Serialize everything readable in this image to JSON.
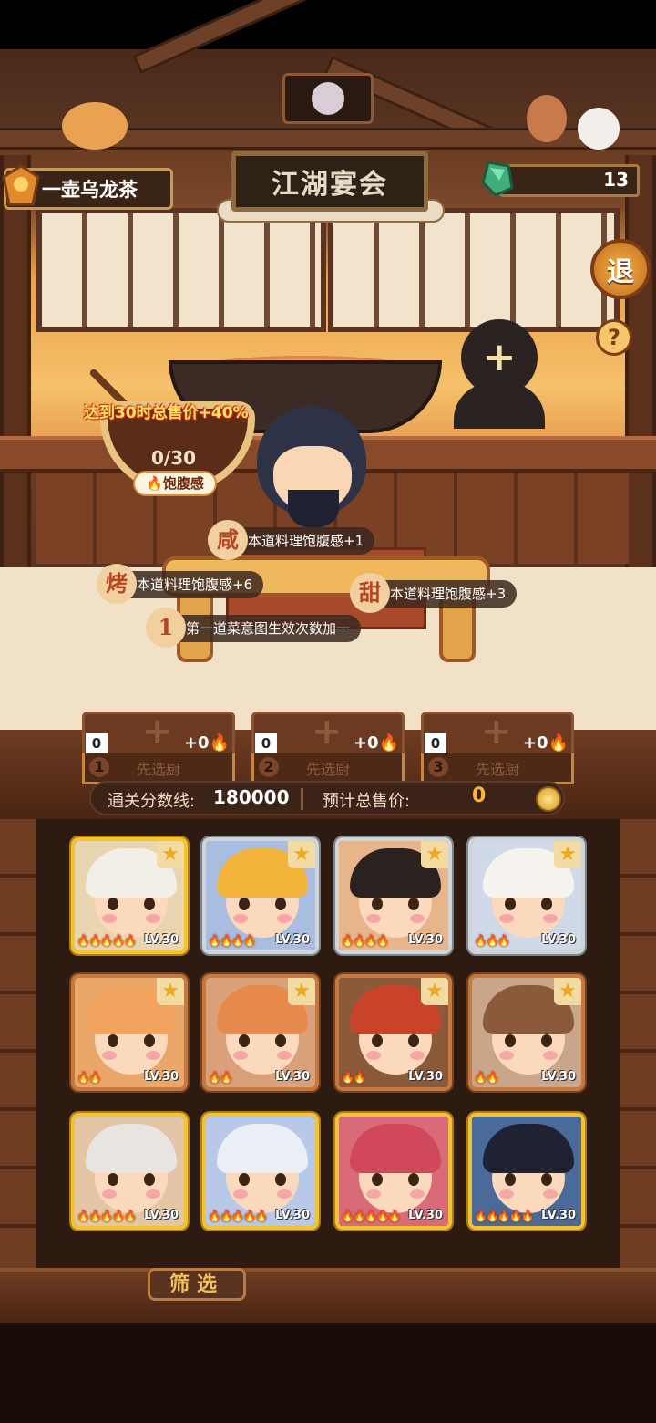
{
  "header": {
    "player_name": "一壶乌龙茶",
    "title": "江湖宴会",
    "gem_count": "13",
    "exit_label": "退",
    "help_label": "?"
  },
  "bowl": {
    "caption": "达到30时总售价+40%",
    "count": "0/30",
    "label": "饱腹感"
  },
  "bonuses": [
    {
      "badge": "咸",
      "text": "本道料理饱腹感+1"
    },
    {
      "badge": "烤",
      "text": "本道料理饱腹感+6"
    },
    {
      "badge": "甜",
      "text": "本道料理饱腹感+3"
    },
    {
      "badge": "1",
      "text": "第一道菜意图生效次数加一"
    }
  ],
  "slots": [
    {
      "zero": "0",
      "bonus": "+0",
      "num": "1",
      "label": "先选厨"
    },
    {
      "zero": "0",
      "bonus": "+0",
      "num": "2",
      "label": "先选厨"
    },
    {
      "zero": "0",
      "bonus": "+0",
      "num": "3",
      "label": "先选厨"
    }
  ],
  "score": {
    "threshold_label": "通关分数线:",
    "threshold_value": "180000",
    "price_label": "预计总售价:",
    "price_value": "0"
  },
  "cards": [
    {
      "level": "LV.30",
      "flames": "🔥🔥🔥🔥🔥",
      "tier": "gold",
      "starred": true
    },
    {
      "level": "LV.30",
      "flames": "🔥🔥🔥🔥",
      "tier": "silver",
      "starred": true
    },
    {
      "level": "LV.30",
      "flames": "🔥🔥🔥🔥",
      "tier": "silver",
      "starred": true
    },
    {
      "level": "LV.30",
      "flames": "🔥🔥🔥",
      "tier": "silver",
      "starred": true
    },
    {
      "level": "LV.30",
      "flames": "🔥🔥",
      "tier": "bronze",
      "starred": true
    },
    {
      "level": "LV.30",
      "flames": "🔥🔥",
      "tier": "bronze",
      "starred": true
    },
    {
      "level": "LV.30",
      "flames": "🔥🔥",
      "tier": "bronze",
      "starred": true
    },
    {
      "level": "LV.30",
      "flames": "🔥🔥",
      "tier": "bronze",
      "starred": true
    },
    {
      "level": "LV.30",
      "flames": "🔥🔥🔥🔥🔥",
      "tier": "gold",
      "starred": false
    },
    {
      "level": "LV.30",
      "flames": "🔥🔥🔥🔥🔥",
      "tier": "gold",
      "starred": false
    },
    {
      "level": "LV.30",
      "flames": "🔥🔥🔥🔥🔥",
      "tier": "gold",
      "starred": false
    },
    {
      "level": "LV.30",
      "flames": "🔥🔥🔥🔥🔥",
      "tier": "gold",
      "starred": false
    }
  ],
  "filter_label": "筛选",
  "colors": {
    "accent_gold": "#f2c431",
    "price_orange": "#ffb636",
    "caption_yellow": "#ffe36b"
  },
  "icons": [
    "gem-icon",
    "coin-icon",
    "star-icon",
    "flame-icon",
    "exit-icon",
    "help-icon",
    "add-chef-icon"
  ]
}
